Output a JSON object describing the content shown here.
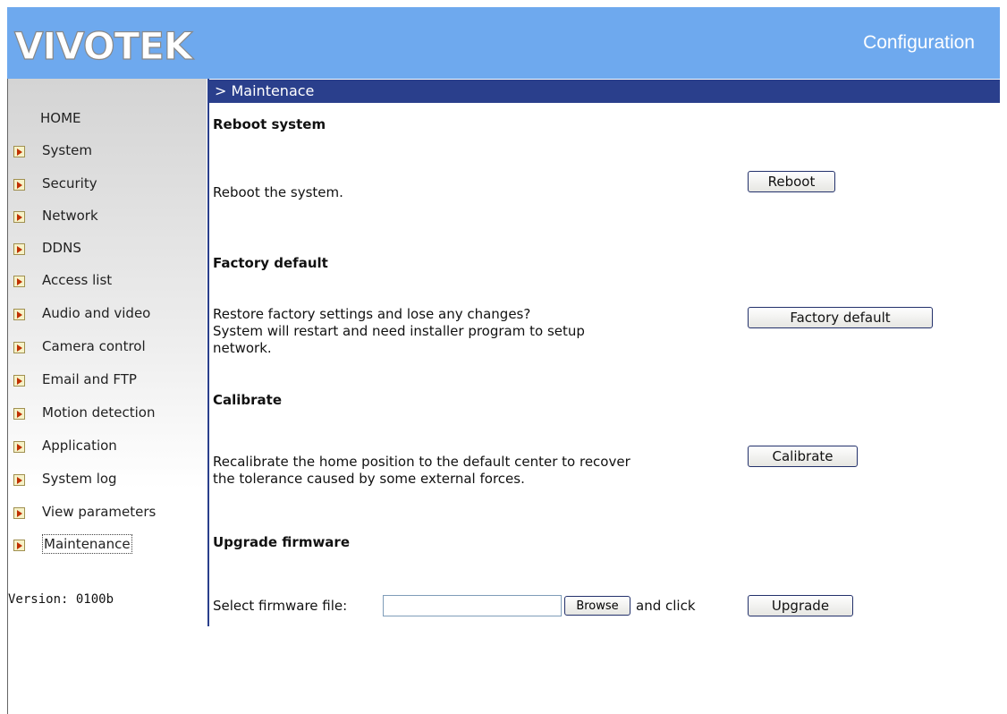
{
  "header": {
    "brand": "VIVOTEK",
    "title": "Configuration",
    "colors": {
      "header_bg": "#6ea9ee",
      "bar": "#2a3f8c"
    }
  },
  "sidebar": {
    "home": "HOME",
    "items": [
      {
        "label": "System"
      },
      {
        "label": "Security"
      },
      {
        "label": "Network"
      },
      {
        "label": "DDNS"
      },
      {
        "label": "Access list"
      },
      {
        "label": "Audio and video"
      },
      {
        "label": "Camera control"
      },
      {
        "label": "Email and FTP"
      },
      {
        "label": "Motion detection"
      },
      {
        "label": "Application"
      },
      {
        "label": "System log"
      },
      {
        "label": "View parameters"
      },
      {
        "label": "Maintenance"
      }
    ],
    "version": "Version: 0100b"
  },
  "main": {
    "breadcrumb": "> Maintenace",
    "reboot": {
      "heading": "Reboot system",
      "desc": "Reboot the system.",
      "button": "Reboot"
    },
    "factory": {
      "heading": "Factory default",
      "desc_line1": "Restore factory settings and lose any changes?",
      "desc_line2": "System will restart and need installer program to setup",
      "desc_line3": "network.",
      "button": "Factory default"
    },
    "calibrate": {
      "heading": "Calibrate",
      "desc_line1": "Recalibrate the home position to the default center to recover",
      "desc_line2": "the tolerance caused by some external forces.",
      "button": "Calibrate"
    },
    "upgrade": {
      "heading": "Upgrade firmware",
      "select_label": "Select firmware file:",
      "file_value": "",
      "browse": "Browse",
      "and_click": "and click",
      "button": "Upgrade"
    }
  }
}
